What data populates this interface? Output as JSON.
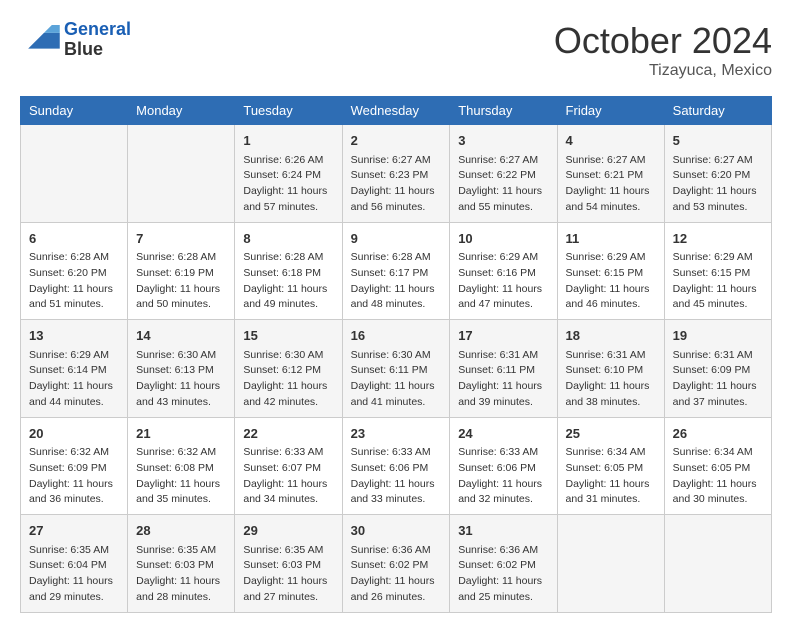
{
  "header": {
    "logo_line1": "General",
    "logo_line2": "Blue",
    "month": "October 2024",
    "location": "Tizayuca, Mexico"
  },
  "weekdays": [
    "Sunday",
    "Monday",
    "Tuesday",
    "Wednesday",
    "Thursday",
    "Friday",
    "Saturday"
  ],
  "weeks": [
    [
      {
        "day": "",
        "lines": []
      },
      {
        "day": "",
        "lines": []
      },
      {
        "day": "1",
        "lines": [
          "Sunrise: 6:26 AM",
          "Sunset: 6:24 PM",
          "Daylight: 11 hours and 57 minutes."
        ]
      },
      {
        "day": "2",
        "lines": [
          "Sunrise: 6:27 AM",
          "Sunset: 6:23 PM",
          "Daylight: 11 hours and 56 minutes."
        ]
      },
      {
        "day": "3",
        "lines": [
          "Sunrise: 6:27 AM",
          "Sunset: 6:22 PM",
          "Daylight: 11 hours and 55 minutes."
        ]
      },
      {
        "day": "4",
        "lines": [
          "Sunrise: 6:27 AM",
          "Sunset: 6:21 PM",
          "Daylight: 11 hours and 54 minutes."
        ]
      },
      {
        "day": "5",
        "lines": [
          "Sunrise: 6:27 AM",
          "Sunset: 6:20 PM",
          "Daylight: 11 hours and 53 minutes."
        ]
      }
    ],
    [
      {
        "day": "6",
        "lines": [
          "Sunrise: 6:28 AM",
          "Sunset: 6:20 PM",
          "Daylight: 11 hours and 51 minutes."
        ]
      },
      {
        "day": "7",
        "lines": [
          "Sunrise: 6:28 AM",
          "Sunset: 6:19 PM",
          "Daylight: 11 hours and 50 minutes."
        ]
      },
      {
        "day": "8",
        "lines": [
          "Sunrise: 6:28 AM",
          "Sunset: 6:18 PM",
          "Daylight: 11 hours and 49 minutes."
        ]
      },
      {
        "day": "9",
        "lines": [
          "Sunrise: 6:28 AM",
          "Sunset: 6:17 PM",
          "Daylight: 11 hours and 48 minutes."
        ]
      },
      {
        "day": "10",
        "lines": [
          "Sunrise: 6:29 AM",
          "Sunset: 6:16 PM",
          "Daylight: 11 hours and 47 minutes."
        ]
      },
      {
        "day": "11",
        "lines": [
          "Sunrise: 6:29 AM",
          "Sunset: 6:15 PM",
          "Daylight: 11 hours and 46 minutes."
        ]
      },
      {
        "day": "12",
        "lines": [
          "Sunrise: 6:29 AM",
          "Sunset: 6:15 PM",
          "Daylight: 11 hours and 45 minutes."
        ]
      }
    ],
    [
      {
        "day": "13",
        "lines": [
          "Sunrise: 6:29 AM",
          "Sunset: 6:14 PM",
          "Daylight: 11 hours and 44 minutes."
        ]
      },
      {
        "day": "14",
        "lines": [
          "Sunrise: 6:30 AM",
          "Sunset: 6:13 PM",
          "Daylight: 11 hours and 43 minutes."
        ]
      },
      {
        "day": "15",
        "lines": [
          "Sunrise: 6:30 AM",
          "Sunset: 6:12 PM",
          "Daylight: 11 hours and 42 minutes."
        ]
      },
      {
        "day": "16",
        "lines": [
          "Sunrise: 6:30 AM",
          "Sunset: 6:11 PM",
          "Daylight: 11 hours and 41 minutes."
        ]
      },
      {
        "day": "17",
        "lines": [
          "Sunrise: 6:31 AM",
          "Sunset: 6:11 PM",
          "Daylight: 11 hours and 39 minutes."
        ]
      },
      {
        "day": "18",
        "lines": [
          "Sunrise: 6:31 AM",
          "Sunset: 6:10 PM",
          "Daylight: 11 hours and 38 minutes."
        ]
      },
      {
        "day": "19",
        "lines": [
          "Sunrise: 6:31 AM",
          "Sunset: 6:09 PM",
          "Daylight: 11 hours and 37 minutes."
        ]
      }
    ],
    [
      {
        "day": "20",
        "lines": [
          "Sunrise: 6:32 AM",
          "Sunset: 6:09 PM",
          "Daylight: 11 hours and 36 minutes."
        ]
      },
      {
        "day": "21",
        "lines": [
          "Sunrise: 6:32 AM",
          "Sunset: 6:08 PM",
          "Daylight: 11 hours and 35 minutes."
        ]
      },
      {
        "day": "22",
        "lines": [
          "Sunrise: 6:33 AM",
          "Sunset: 6:07 PM",
          "Daylight: 11 hours and 34 minutes."
        ]
      },
      {
        "day": "23",
        "lines": [
          "Sunrise: 6:33 AM",
          "Sunset: 6:06 PM",
          "Daylight: 11 hours and 33 minutes."
        ]
      },
      {
        "day": "24",
        "lines": [
          "Sunrise: 6:33 AM",
          "Sunset: 6:06 PM",
          "Daylight: 11 hours and 32 minutes."
        ]
      },
      {
        "day": "25",
        "lines": [
          "Sunrise: 6:34 AM",
          "Sunset: 6:05 PM",
          "Daylight: 11 hours and 31 minutes."
        ]
      },
      {
        "day": "26",
        "lines": [
          "Sunrise: 6:34 AM",
          "Sunset: 6:05 PM",
          "Daylight: 11 hours and 30 minutes."
        ]
      }
    ],
    [
      {
        "day": "27",
        "lines": [
          "Sunrise: 6:35 AM",
          "Sunset: 6:04 PM",
          "Daylight: 11 hours and 29 minutes."
        ]
      },
      {
        "day": "28",
        "lines": [
          "Sunrise: 6:35 AM",
          "Sunset: 6:03 PM",
          "Daylight: 11 hours and 28 minutes."
        ]
      },
      {
        "day": "29",
        "lines": [
          "Sunrise: 6:35 AM",
          "Sunset: 6:03 PM",
          "Daylight: 11 hours and 27 minutes."
        ]
      },
      {
        "day": "30",
        "lines": [
          "Sunrise: 6:36 AM",
          "Sunset: 6:02 PM",
          "Daylight: 11 hours and 26 minutes."
        ]
      },
      {
        "day": "31",
        "lines": [
          "Sunrise: 6:36 AM",
          "Sunset: 6:02 PM",
          "Daylight: 11 hours and 25 minutes."
        ]
      },
      {
        "day": "",
        "lines": []
      },
      {
        "day": "",
        "lines": []
      }
    ]
  ]
}
